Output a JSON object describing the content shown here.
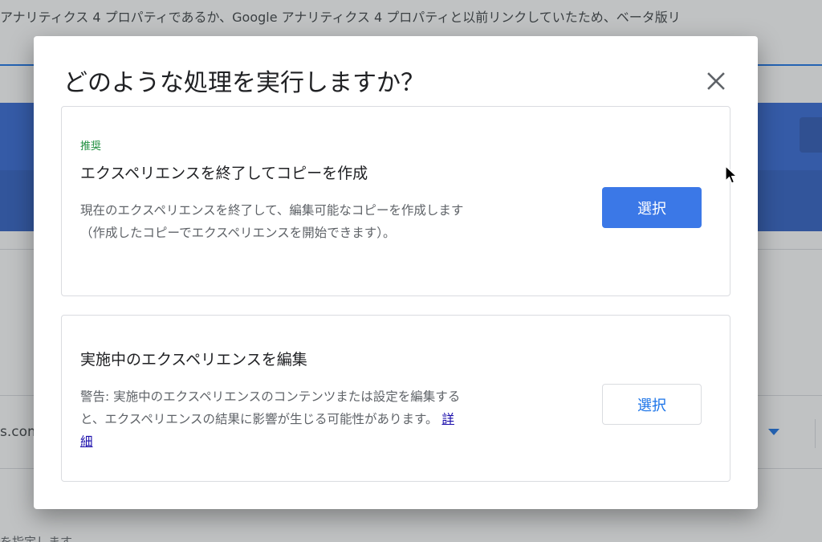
{
  "background": {
    "banner_text": "アナリティクス 4 プロパティであるか、Google アナリティクス 4 プロパティと以前リンクしていたため、ベータ版リ",
    "field_text": "s.com",
    "bottom_text": "を指定します"
  },
  "dialog": {
    "title": "どのような処理を実行しますか？",
    "close_icon": "close-icon",
    "options": [
      {
        "tag": "推奨",
        "title": "エクスペリエンスを終了してコピーを作成",
        "description": "現在のエクスペリエンスを終了して、編集可能なコピーを作成します（作成したコピーでエクスペリエンスを開始できます）。",
        "button_label": "選択"
      },
      {
        "title": "実施中のエクスペリエンスを編集",
        "description": "警告: 実施中のエクスペリエンスのコンテンツまたは設定を編集すると、エクスペリエンスの結果に影響が生じる可能性があります。",
        "link_label": "詳細",
        "button_label": "選択"
      }
    ]
  },
  "colors": {
    "primary": "#3b78e7",
    "tag_green": "#1e8e3e",
    "link": "#1a0dab",
    "toolbar_blue": "#3367d6"
  }
}
